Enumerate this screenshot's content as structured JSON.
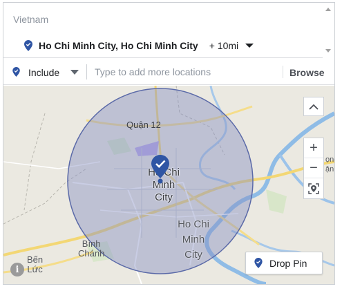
{
  "colors": {
    "accent": "#4267b2",
    "pin": "#2f55a4",
    "radius_fill": "#8791c4",
    "radius_stroke": "#5b6aa8"
  },
  "location_list": {
    "country": "Vietnam",
    "selected": {
      "name": "Ho Chi Minh City, Ho Chi Minh City",
      "radius": "+ 10mi",
      "icon": "map-pin-icon"
    }
  },
  "include_row": {
    "mode": "Include",
    "placeholder": "Type to add more locations",
    "browse_label": "Browse"
  },
  "map": {
    "labels": {
      "district": "Quận 12",
      "city_line1": "Ho Chi Minh",
      "city_line2": "City",
      "province_line1": "Ho Chi",
      "province_line2": "Minh",
      "province_line3": "City",
      "binh_line1": "Bình",
      "binh_line2": "Chánh",
      "ben_line1": "Bến",
      "ben_line2": "Lức",
      "edge_top": "ọng",
      "edge_bottom": "ận"
    },
    "controls": {
      "collapse": "^",
      "zoom_in": "+",
      "zoom_out": "−"
    },
    "drop_pin_label": "Drop Pin",
    "info_glyph": "i"
  }
}
